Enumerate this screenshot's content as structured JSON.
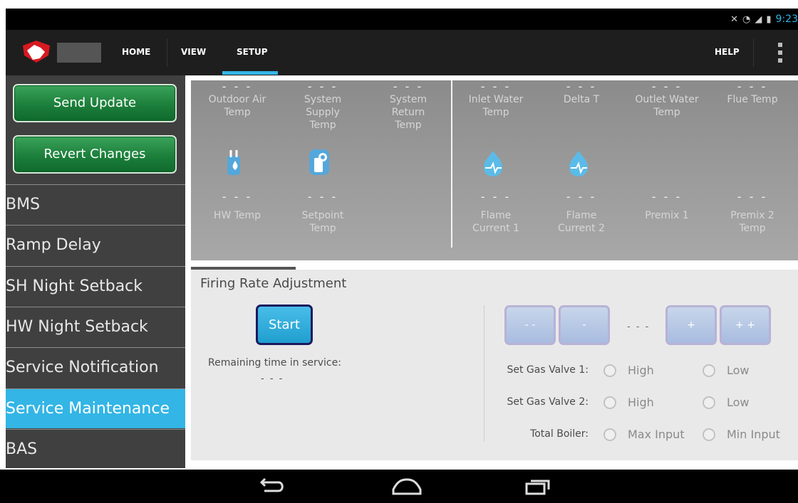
{
  "status_bar": {
    "time": "9:23"
  },
  "top_nav": {
    "home": "HOME",
    "view": "VIEW",
    "setup": "SETUP",
    "help": "HELP"
  },
  "sidebar": {
    "send_update": "Send Update",
    "revert_changes": "Revert Changes",
    "items": [
      {
        "label": "BMS"
      },
      {
        "label": "Ramp Delay"
      },
      {
        "label": "SH Night Setback"
      },
      {
        "label": "HW Night Setback"
      },
      {
        "label": "Service Notification"
      },
      {
        "label": "Service Maintenance",
        "active": true
      },
      {
        "label": "BAS"
      }
    ]
  },
  "sensors": {
    "dash": "- - -",
    "outdoor_air": "Outdoor Air\nTemp",
    "system_supply": "System\nSupply\nTemp",
    "system_return": "System\nReturn\nTemp",
    "inlet_water": "Inlet Water\nTemp",
    "delta_t": "Delta T",
    "outlet_water": "Outlet Water\nTemp",
    "flue_temp": "Flue Temp",
    "hw_temp": "HW Temp",
    "setpoint": "Setpoint\nTemp",
    "flame1": "Flame\nCurrent 1",
    "flame2": "Flame\nCurrent 2",
    "premix1": "Premix 1",
    "premix2": "Premix 2\nTemp"
  },
  "firing": {
    "title": "Firing Rate Adjustment",
    "start": "Start",
    "remaining_label": "Remaining time in service:",
    "remaining_value": "- - -",
    "btn_dec2": "- -",
    "btn_dec1": "-",
    "value": "- - -",
    "btn_inc1": "+",
    "btn_inc2": "+ +",
    "gas1": "Set Gas Valve 1:",
    "gas2": "Set Gas Valve 2:",
    "total": "Total Boiler:",
    "high": "High",
    "low": "Low",
    "max_input": "Max Input",
    "min_input": "Min Input"
  },
  "colors": {
    "accent": "#33b5e5",
    "green_button": "#1c7f3b"
  }
}
